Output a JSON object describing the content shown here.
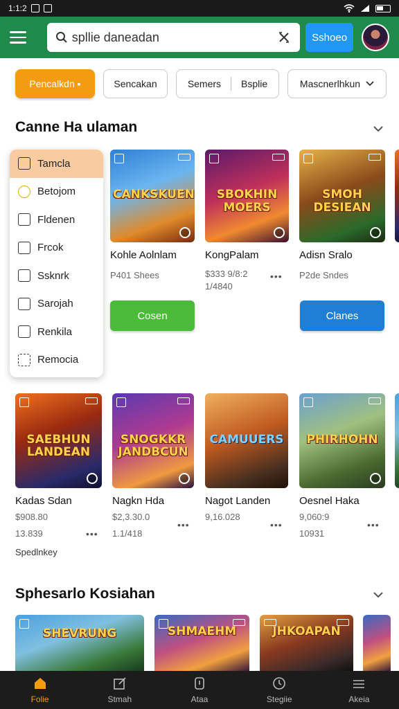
{
  "status": {
    "time": "1:1:2"
  },
  "search": {
    "value": "spllie daneadan",
    "button": "Sshoeo"
  },
  "filters": [
    {
      "label": "Pencalkdn ▪"
    },
    {
      "label": "Sencakan"
    },
    {
      "label_a": "Semers",
      "label_b": "Bsplie"
    },
    {
      "label": "Mascnerlhkun"
    }
  ],
  "section1": {
    "title": "Canne Ha ulaman"
  },
  "dropdown": {
    "items": [
      {
        "label": "Tamcla"
      },
      {
        "label": "Betojom"
      },
      {
        "label": "Fldenen"
      },
      {
        "label": "Frcok"
      },
      {
        "label": "Ssknrk"
      },
      {
        "label": "Sarojah"
      },
      {
        "label": "Renkila"
      },
      {
        "label": "Remocia"
      }
    ]
  },
  "row1": [
    {
      "art_title": "CANKSKUEN",
      "name": "Kohle Aolnlam",
      "meta1": "P401 Shees",
      "meta2": "",
      "cta": "Cosen",
      "cta_color": "#4cbb3a"
    },
    {
      "art_title": "SBOKHIN MOERS",
      "name": "KongPalam",
      "meta1": "$333 9/8:2",
      "meta2": "1/4840",
      "cta": "",
      "cta_color": ""
    },
    {
      "art_title": "SMOH DESIEAN",
      "name": "Adisn Sralo",
      "meta1": "P2de Sndes",
      "meta2": "",
      "cta": "Clanes",
      "cta_color": "#1f7fd6"
    }
  ],
  "row2": [
    {
      "art_title": "SAEBHUN LANDEAN",
      "name": "Kadas Sdan",
      "price": "$908.80",
      "count": "13.839"
    },
    {
      "art_title": "SNOGKKR JANDBCUN",
      "name": "Nagkn Hda",
      "price": "$2,3.30.0",
      "count": "1.1/418"
    },
    {
      "art_title": "CAMUUERS",
      "name": "Nagot Landen",
      "price": "9,16.028",
      "count": ""
    },
    {
      "art_title": "PHIRHOHN",
      "name": "Oesnel Haka",
      "price": "9,060:9",
      "count": "10931"
    }
  ],
  "row2_extra": "Spedlnkey",
  "section2": {
    "title": "Sphesarlo Kosiahan"
  },
  "row3": [
    {
      "art_title": "SHEVRUNG"
    },
    {
      "art_title": "SHMAEHM"
    },
    {
      "art_title": "JHKOAPAN"
    }
  ],
  "bottom_nav": [
    {
      "label": "Folie",
      "icon": "home-icon",
      "active": true
    },
    {
      "label": "Stmah",
      "icon": "edit-icon",
      "active": false
    },
    {
      "label": "Ataa",
      "icon": "box-icon",
      "active": false
    },
    {
      "label": "Stegiie",
      "icon": "clock-icon",
      "active": false
    },
    {
      "label": "Akeia",
      "icon": "more-icon",
      "active": false
    }
  ]
}
